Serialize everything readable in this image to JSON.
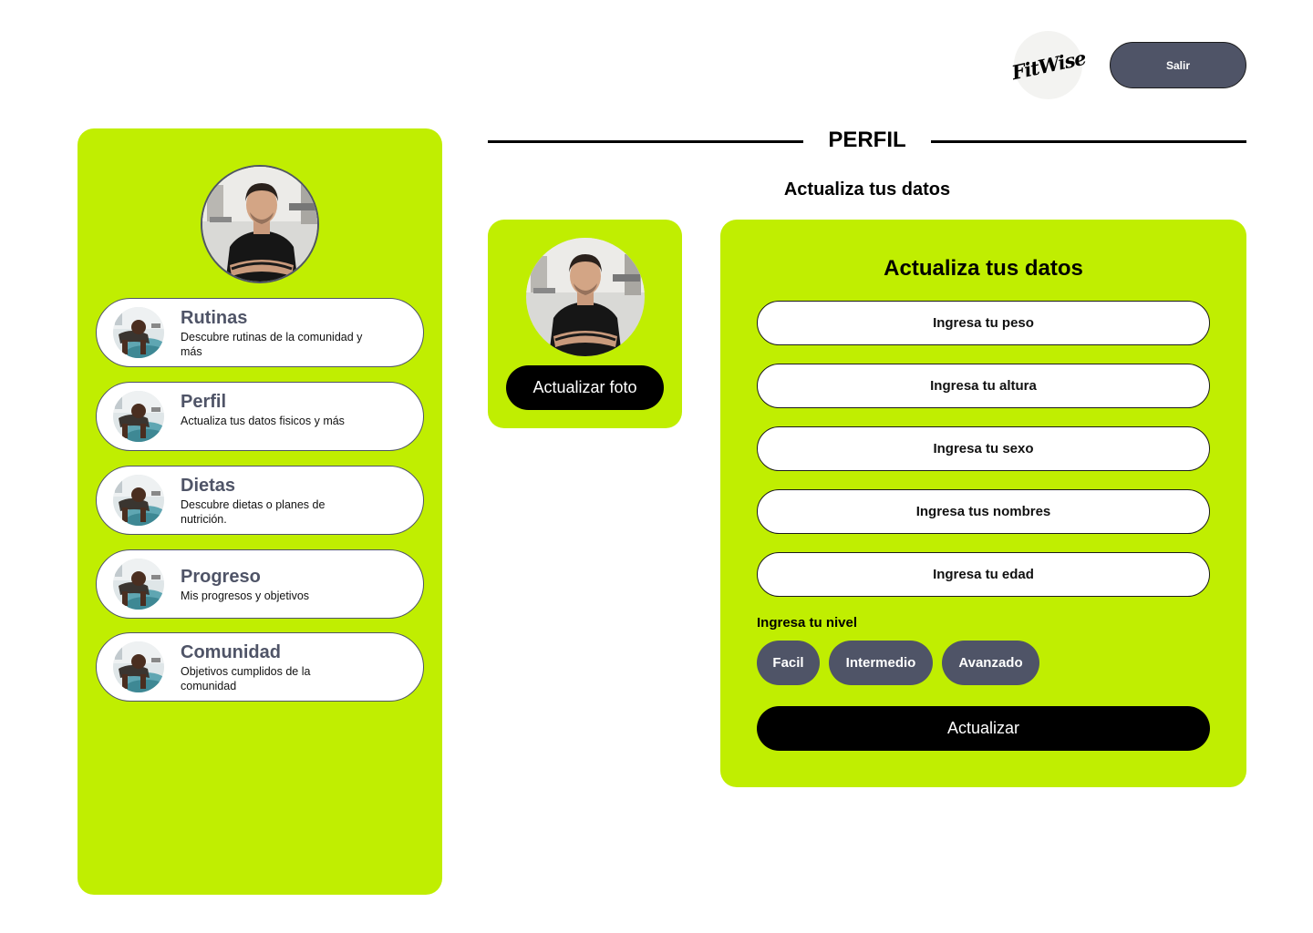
{
  "header": {
    "logo_text": "FitWise",
    "logout_label": "Salir"
  },
  "sidebar": {
    "items": [
      {
        "title": "Rutinas",
        "description": "Descubre rutinas de la comunidad y más"
      },
      {
        "title": "Perfil",
        "description": "Actualiza tus datos fisicos y más"
      },
      {
        "title": "Dietas",
        "description": "Descubre dietas o planes de nutrición."
      },
      {
        "title": "Progreso",
        "description": "Mis progresos y objetivos"
      },
      {
        "title": "Comunidad",
        "description": "Objetivos cumplidos de la comunidad"
      }
    ]
  },
  "main": {
    "page_title": "PERFIL",
    "subtitle": "Actualiza tus datos",
    "photo_button": "Actualizar foto",
    "form": {
      "title": "Actualiza tus datos",
      "fields": [
        {
          "placeholder": "Ingresa tu peso",
          "value": ""
        },
        {
          "placeholder": "Ingresa tu altura",
          "value": ""
        },
        {
          "placeholder": "Ingresa tu sexo",
          "value": ""
        },
        {
          "placeholder": "Ingresa tus nombres",
          "value": ""
        },
        {
          "placeholder": "Ingresa tu edad",
          "value": ""
        }
      ],
      "level_label": "Ingresa tu nivel",
      "levels": [
        "Facil",
        "Intermedio",
        "Avanzado"
      ],
      "submit_label": "Actualizar"
    }
  },
  "colors": {
    "accent": "#c0ee01",
    "slate": "#4f5467",
    "black": "#000000"
  },
  "icons": {
    "profile_avatar": "trainer-photo",
    "nav_thumbnail": "pushup-athlete-photo"
  }
}
